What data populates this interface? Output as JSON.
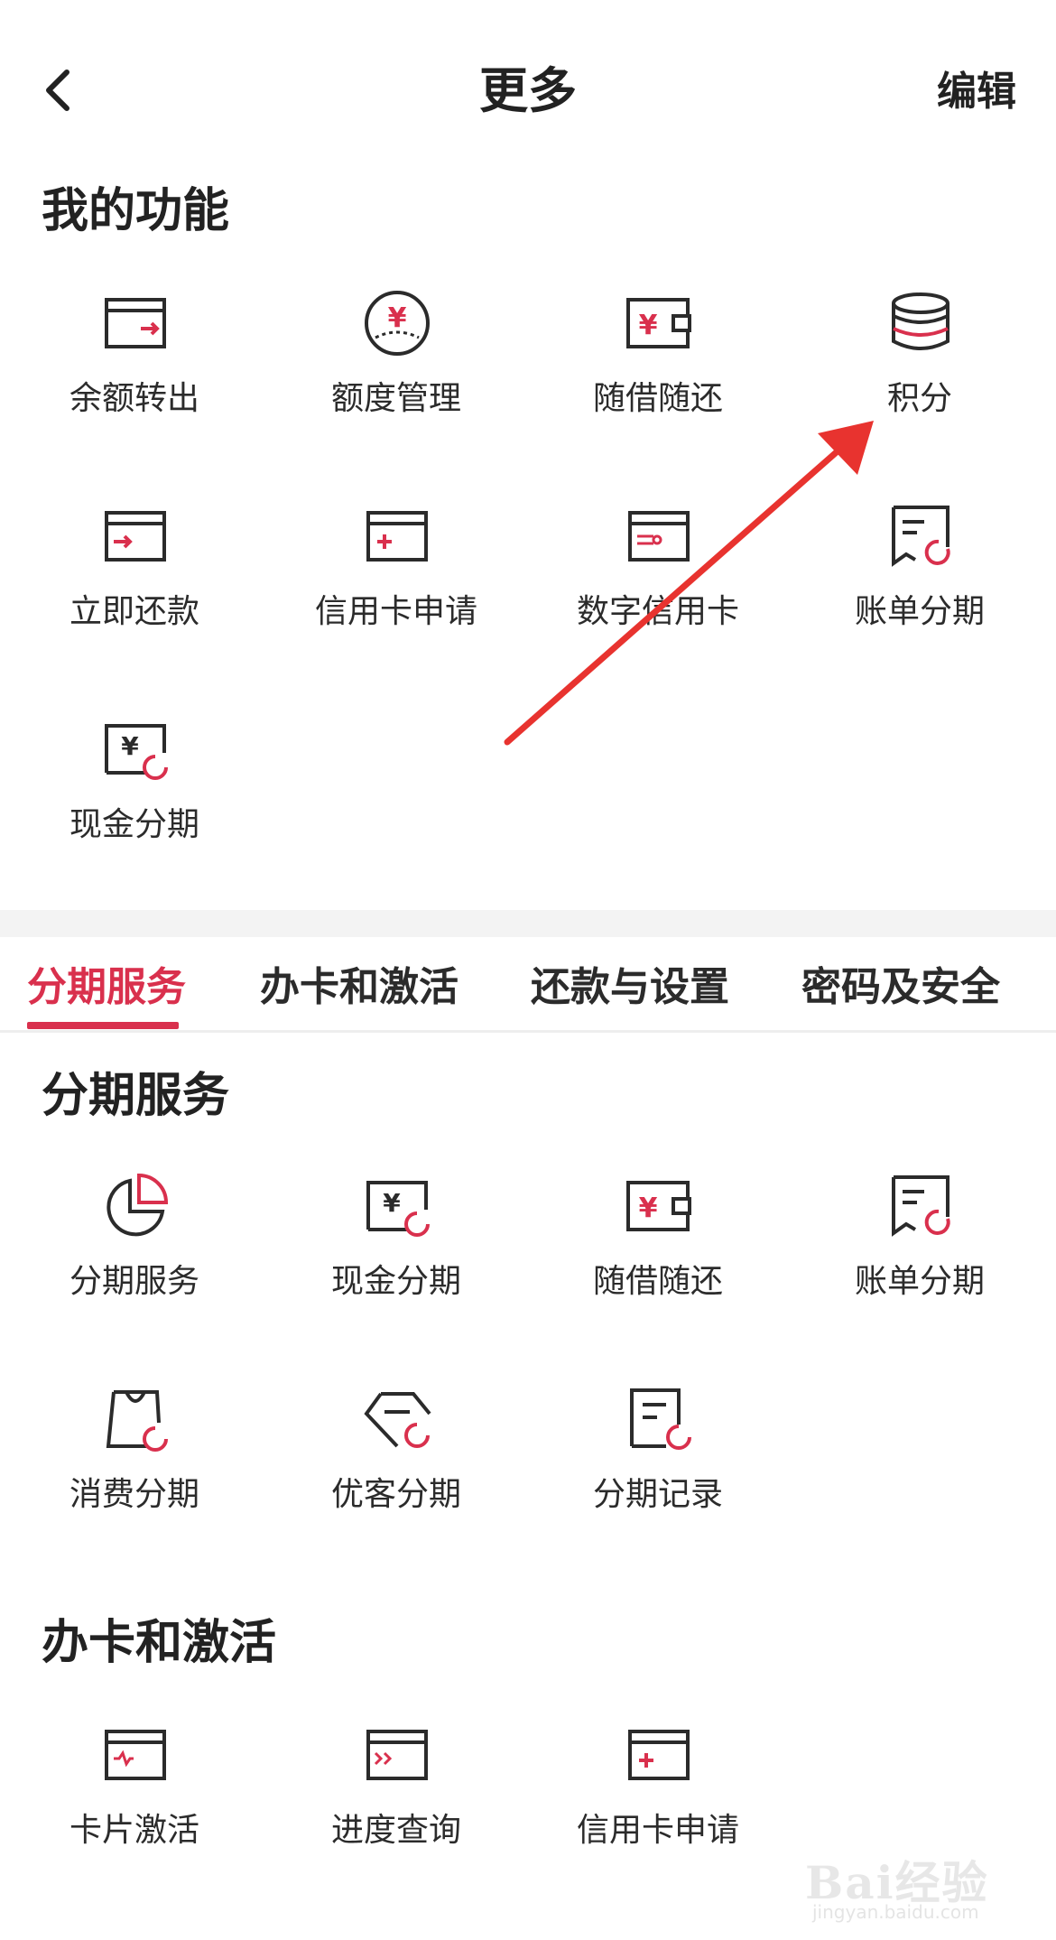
{
  "header": {
    "title": "更多",
    "edit_label": "编辑"
  },
  "my_functions": {
    "title": "我的功能",
    "items": [
      {
        "label": "余额转出",
        "icon": "card-transfer-out-icon"
      },
      {
        "label": "额度管理",
        "icon": "yuan-gauge-icon"
      },
      {
        "label": "随借随还",
        "icon": "yuan-wallet-icon"
      },
      {
        "label": "积分",
        "icon": "coin-stack-icon"
      },
      {
        "label": "立即还款",
        "icon": "card-repay-icon"
      },
      {
        "label": "信用卡申请",
        "icon": "card-add-icon"
      },
      {
        "label": "数字信用卡",
        "icon": "digital-card-icon"
      },
      {
        "label": "账单分期",
        "icon": "bill-installment-icon"
      },
      {
        "label": "现金分期",
        "icon": "cash-installment-icon"
      }
    ]
  },
  "tabs": [
    "分期服务",
    "办卡和激活",
    "还款与设置",
    "密码及安全"
  ],
  "installment": {
    "title": "分期服务",
    "items": [
      {
        "label": "分期服务",
        "icon": "pie-chart-icon"
      },
      {
        "label": "现金分期",
        "icon": "cash-installment-icon"
      },
      {
        "label": "随借随还",
        "icon": "yuan-wallet-icon"
      },
      {
        "label": "账单分期",
        "icon": "bill-installment-icon"
      },
      {
        "label": "消费分期",
        "icon": "shopping-bag-icon"
      },
      {
        "label": "优客分期",
        "icon": "diamond-icon"
      },
      {
        "label": "分期记录",
        "icon": "record-doc-icon"
      }
    ]
  },
  "card_activation": {
    "title": "办卡和激活",
    "items": [
      {
        "label": "卡片激活",
        "icon": "card-activate-icon"
      },
      {
        "label": "进度查询",
        "icon": "card-progress-icon"
      },
      {
        "label": "信用卡申请",
        "icon": "card-add-icon"
      }
    ]
  },
  "watermark": {
    "brand": "Bai经验",
    "url": "jingyan.baidu.com"
  },
  "colors": {
    "accent": "#d9304d",
    "text": "#2b2b2b",
    "arrow": "#e8332f"
  }
}
